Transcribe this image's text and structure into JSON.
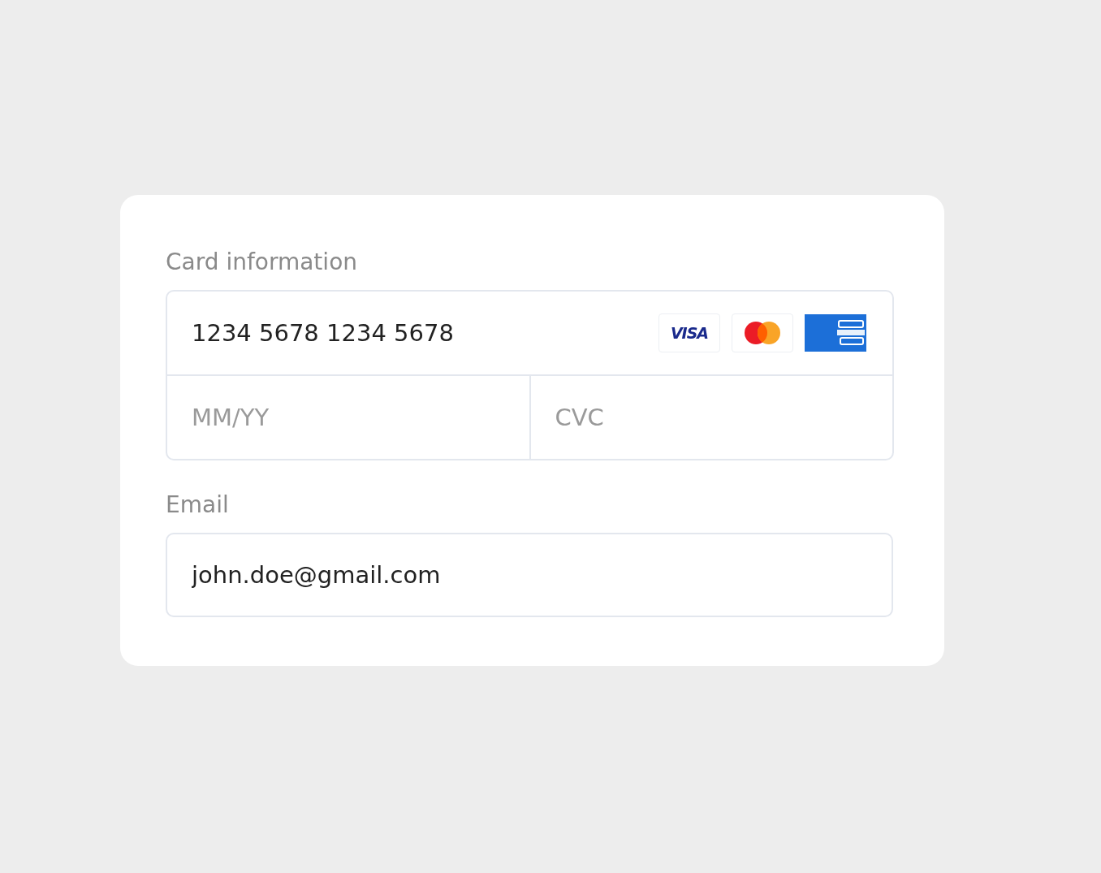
{
  "card_information": {
    "label": "Card information",
    "card_number": {
      "value": "1234 5678 1234 5678"
    },
    "brands": [
      {
        "kind": "visa",
        "text": "VISA"
      },
      {
        "kind": "mastercard"
      },
      {
        "kind": "amex"
      }
    ],
    "expiry": {
      "placeholder": "MM/YY"
    },
    "cvc": {
      "placeholder": "CVC"
    }
  },
  "email": {
    "label": "Email",
    "value": "john.doe@gmail.com"
  }
}
